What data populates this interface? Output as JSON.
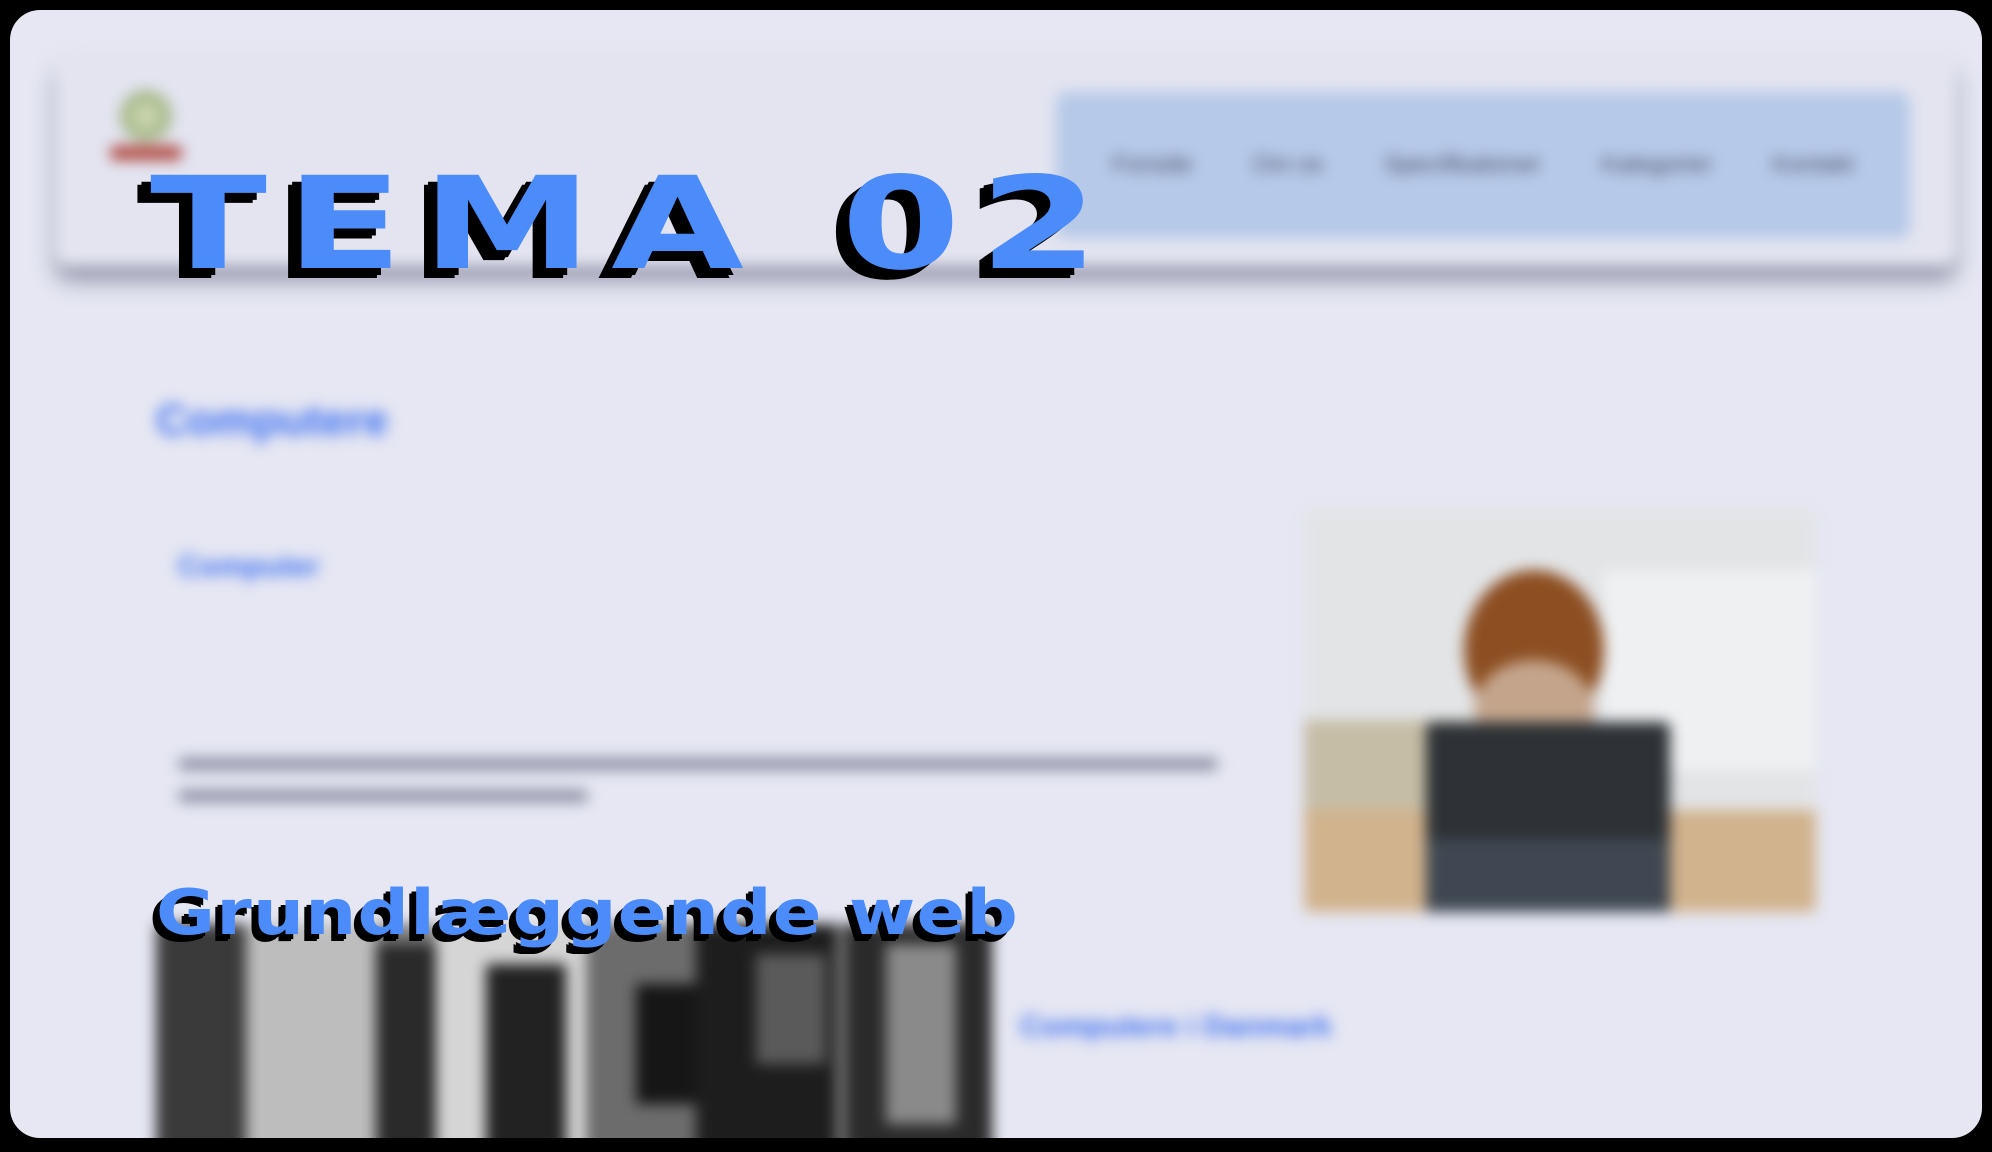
{
  "overlay": {
    "title": "TEMA 02",
    "subtitle": "Grundlæggende web"
  },
  "site": {
    "nav": [
      "Forside",
      "Om os",
      "Specifikationer",
      "Kategorier",
      "Kontakt"
    ],
    "page_heading": "Computere",
    "section_link": "Computer",
    "body_text": "",
    "bottom_link": "Computere i Danmark"
  },
  "colors": {
    "accent_blue": "#4b8cfa",
    "link_blue": "#3b6ff0",
    "page_bg": "#e6e7f3",
    "nav_bg": "#b6c9e8"
  },
  "icons": {
    "logo": "site-logo-icon"
  }
}
